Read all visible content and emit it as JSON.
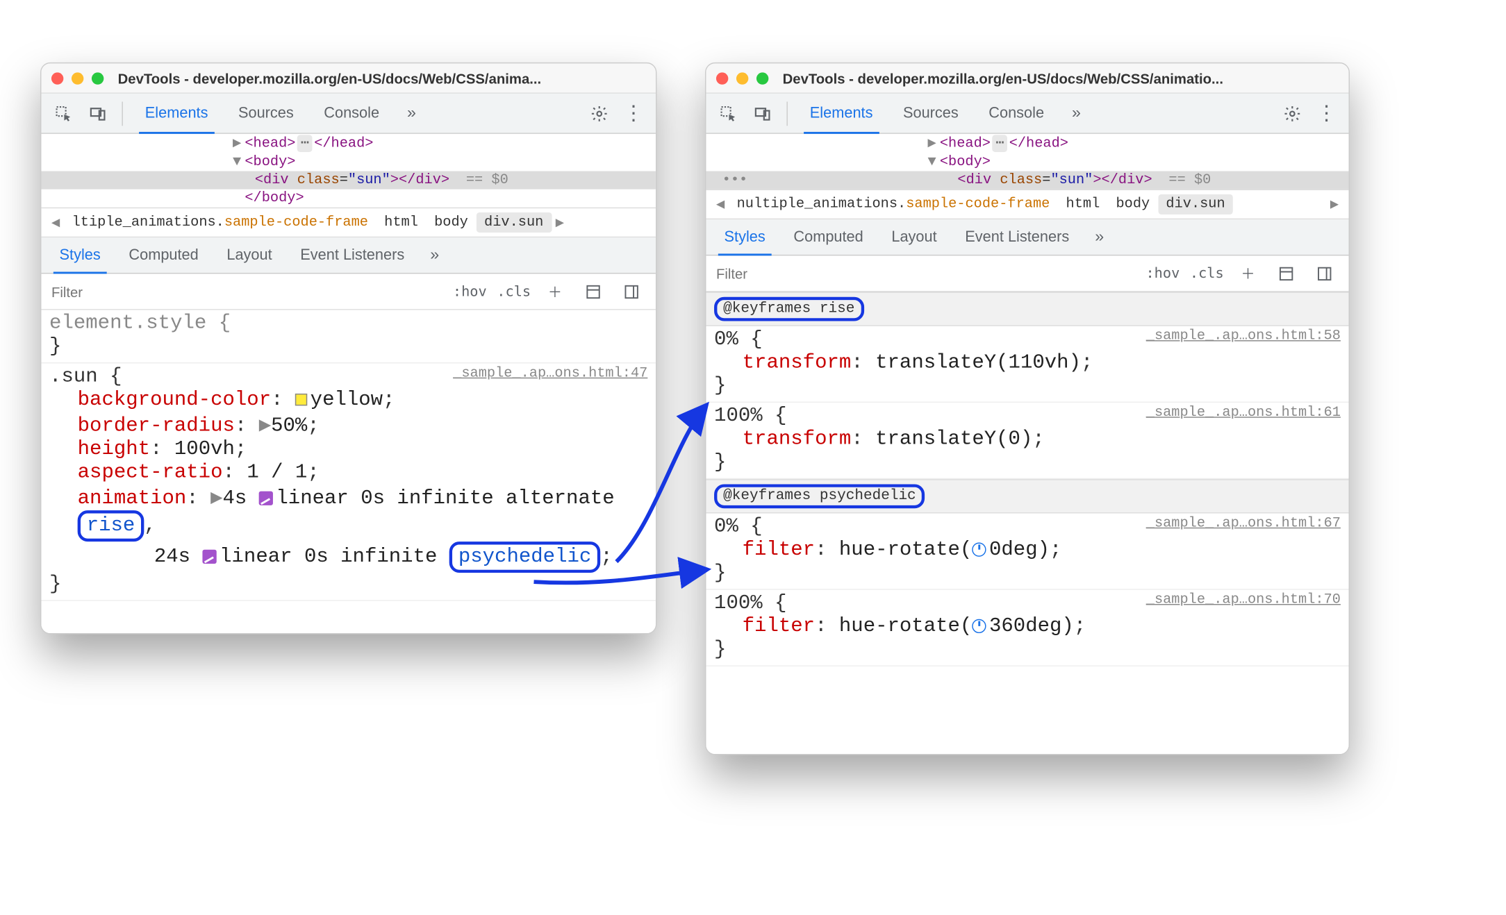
{
  "left": {
    "title": "DevTools - developer.mozilla.org/en-US/docs/Web/CSS/anima...",
    "tabs": {
      "elements": "Elements",
      "sources": "Sources",
      "console": "Console"
    },
    "dom": {
      "head_open": "<head>",
      "head_close": "</head>",
      "body_open": "<body>",
      "body_close": "</body>",
      "div_line_tag_open": "<div ",
      "div_line_attr_name": "class",
      "div_line_attr_val": "\"sun\"",
      "div_line_tag_close": "></div>",
      "eqz": "== $0"
    },
    "crumbs": {
      "lead": "ltiple_animations.",
      "frame": "sample-code-frame",
      "html": "html",
      "body": "body",
      "sel": "div.sun"
    },
    "subtabs": {
      "styles": "Styles",
      "computed": "Computed",
      "layout": "Layout",
      "listeners": "Event Listeners"
    },
    "filter": {
      "placeholder": "Filter",
      "hov": ":hov",
      "cls": ".cls"
    },
    "rules": {
      "elstyle_sel": "element.style {",
      "sun_sel": ".sun {",
      "sun_src": "_sample_.ap…ons.html:47",
      "p_bg": "background-color",
      "v_bg": "yellow",
      "p_br": "border-radius",
      "v_br": "50%",
      "p_h": "height",
      "v_h": "100vh",
      "p_ar": "aspect-ratio",
      "v_ar": "1 / 1",
      "p_an": "animation",
      "v_an_1a": "4s ",
      "v_an_1b": "linear 0s infinite alternate ",
      "v_an_1c": "rise",
      "v_an_2a": "24s ",
      "v_an_2b": "linear 0s infinite ",
      "v_an_2c": "psychedelic"
    }
  },
  "right": {
    "title": "DevTools - developer.mozilla.org/en-US/docs/Web/CSS/animatio...",
    "tabs": {
      "elements": "Elements",
      "sources": "Sources",
      "console": "Console"
    },
    "dom": {
      "head_open": "<head>",
      "head_close": "</head>",
      "body_open": "<body>",
      "div_line_tag_open": "<div ",
      "div_line_attr_name": "class",
      "div_line_attr_val": "\"sun\"",
      "div_line_tag_close": "></div>",
      "eqz": "== $0"
    },
    "crumbs": {
      "lead": "nultiple_animations.",
      "frame": "sample-code-frame",
      "html": "html",
      "body": "body",
      "sel": "div.sun"
    },
    "subtabs": {
      "styles": "Styles",
      "computed": "Computed",
      "layout": "Layout",
      "listeners": "Event Listeners"
    },
    "filter": {
      "placeholder": "Filter",
      "hov": ":hov",
      "cls": ".cls"
    },
    "kf": {
      "rise_hdr": "@keyframes rise",
      "rise_0_src": "_sample_.ap…ons.html:58",
      "rise_0_sel": "0% {",
      "rise_0_prop": "transform",
      "rise_0_val": "translateY(110vh)",
      "rise_100_src": "_sample_.ap…ons.html:61",
      "rise_100_sel": "100% {",
      "rise_100_prop": "transform",
      "rise_100_val": "translateY(0)",
      "psy_hdr": "@keyframes psychedelic",
      "psy_0_src": "_sample_.ap…ons.html:67",
      "psy_0_sel": "0% {",
      "psy_0_prop": "filter",
      "psy_0_vala": "hue-rotate(",
      "psy_0_valb": "0deg)",
      "psy_100_src": "_sample_.ap…ons.html:70",
      "psy_100_sel": "100% {",
      "psy_100_prop": "filter",
      "psy_100_vala": "hue-rotate(",
      "psy_100_valb": "360deg)"
    }
  }
}
